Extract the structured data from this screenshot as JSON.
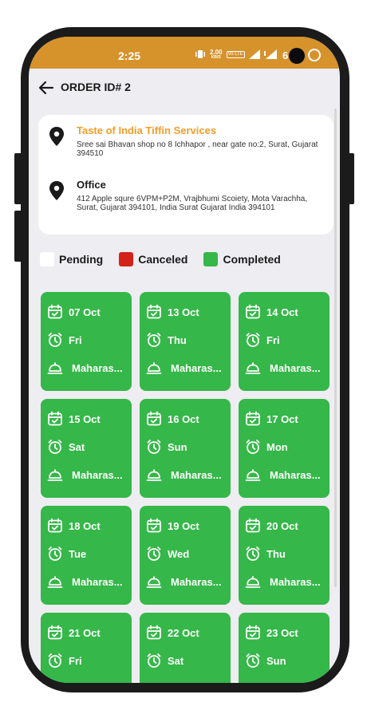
{
  "status": {
    "time": "2:25",
    "speed_value": "2.00",
    "speed_unit": "KB/S",
    "volte": "Vo LTE",
    "trail": "6"
  },
  "header": {
    "title": "ORDER ID# 2"
  },
  "pickup": {
    "name": "Taste of India Tiffin Services",
    "address": "Sree sai Bhavan shop no 8 Ichhapor , near gate no:2, Surat, Gujarat 394510"
  },
  "dropoff": {
    "name": "Office",
    "address": "412 Apple squre 6VPM+P2M, Vrajbhumi Scoiety, Mota Varachha, Surat, Gujarat 394101, India Surat Gujarat India 394101"
  },
  "legend": [
    {
      "label": "Pending",
      "color": "#ffffff"
    },
    {
      "label": "Canceled",
      "color": "#d3221a"
    },
    {
      "label": "Completed",
      "color": "#35b749"
    }
  ],
  "days": [
    {
      "date": "07 Oct",
      "weekday": "Fri",
      "meal": "Maharas..."
    },
    {
      "date": "13 Oct",
      "weekday": "Thu",
      "meal": "Maharas..."
    },
    {
      "date": "14 Oct",
      "weekday": "Fri",
      "meal": "Maharas..."
    },
    {
      "date": "15 Oct",
      "weekday": "Sat",
      "meal": "Maharas..."
    },
    {
      "date": "16 Oct",
      "weekday": "Sun",
      "meal": "Maharas..."
    },
    {
      "date": "17 Oct",
      "weekday": "Mon",
      "meal": "Maharas..."
    },
    {
      "date": "18 Oct",
      "weekday": "Tue",
      "meal": "Maharas..."
    },
    {
      "date": "19 Oct",
      "weekday": "Wed",
      "meal": "Maharas..."
    },
    {
      "date": "20 Oct",
      "weekday": "Thu",
      "meal": "Maharas..."
    },
    {
      "date": "21 Oct",
      "weekday": "Fri",
      "meal": ""
    },
    {
      "date": "22 Oct",
      "weekday": "Sat",
      "meal": ""
    },
    {
      "date": "23 Oct",
      "weekday": "Sun",
      "meal": ""
    }
  ],
  "colors": {
    "accent": "#d6922b",
    "completed": "#35b749",
    "pickup_name": "#f29d2a"
  }
}
